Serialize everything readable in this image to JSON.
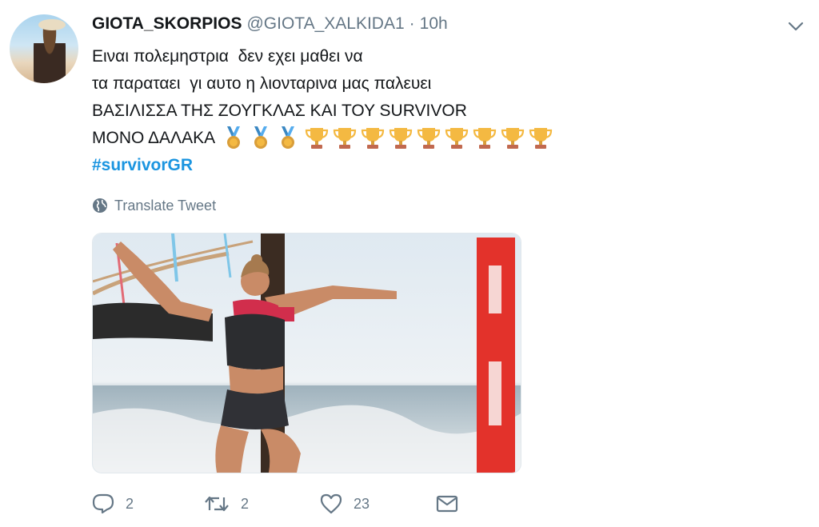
{
  "tweet": {
    "display_name": "GIOTA_SKORPIOS",
    "handle": "@GIOTA_XALKIDA1",
    "separator": "·",
    "time": "10h",
    "lines": [
      "Ειναι πολεμηστρια  δεν εχει μαθει να",
      "τα παραταει  γι αυτο η λιονταρινα μας παλευει",
      "ΒΑΣΙΛΙΣΣΑ ΤΗΣ ΖΟΥΓΚΛΑΣ ΚΑΙ ΤΟΥ SURVIVOR",
      "ΜΟΝΟ ΔΑΛΑΚΑ"
    ],
    "emoji": {
      "medal_icon": "sports-medal",
      "medal_count": 3,
      "trophy_icon": "trophy",
      "trophy_count": 9
    },
    "hashtag": "#survivorGR",
    "translate_label": "Translate Tweet"
  },
  "actions": {
    "reply_count": "2",
    "retweet_count": "2",
    "like_count": "23"
  },
  "colors": {
    "link": "#1b95e0",
    "muted": "#657786",
    "text": "#14171a"
  }
}
